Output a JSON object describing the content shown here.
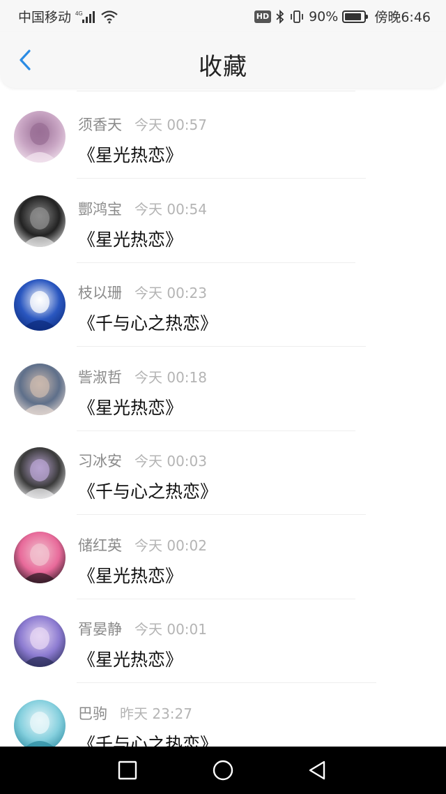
{
  "status_bar": {
    "carrier": "中国移动",
    "network": "4G",
    "hd": "HD",
    "battery_percent_label": "90%",
    "battery_level": 0.9,
    "time": "傍晚6:46"
  },
  "header": {
    "title": "收藏"
  },
  "favorites": [
    {
      "name": "须香天",
      "time": "今天 00:57",
      "title": "《星光热恋》",
      "avatar": {
        "colors": [
          "#f4e6f0",
          "#c9a6c4",
          "#9a6f96"
        ]
      }
    },
    {
      "name": "酆鸿宝",
      "time": "今天 00:54",
      "title": "《星光热恋》",
      "avatar": {
        "colors": [
          "#e8e8e8",
          "#222222",
          "#8c8c8c"
        ]
      }
    },
    {
      "name": "枝以珊",
      "time": "今天 00:23",
      "title": "《千与心之热恋》",
      "avatar": {
        "colors": [
          "#0b2a7a",
          "#2a57c0",
          "#ffffff"
        ]
      }
    },
    {
      "name": "訾淑哲",
      "time": "今天 00:18",
      "title": "《星光热恋》",
      "avatar": {
        "colors": [
          "#e6d9d2",
          "#5e6f8a",
          "#c9b8ae"
        ]
      }
    },
    {
      "name": "习冰安",
      "time": "今天 00:03",
      "title": "《千与心之热恋》",
      "avatar": {
        "colors": [
          "#f2f2f4",
          "#3a3a3a",
          "#b7a3d0"
        ]
      }
    },
    {
      "name": "储红英",
      "time": "今天 00:02",
      "title": "《星光热恋》",
      "avatar": {
        "colors": [
          "#2a1620",
          "#e86a9a",
          "#f1c2cf"
        ]
      }
    },
    {
      "name": "胥晏静",
      "time": "今天 00:01",
      "title": "《星光热恋》",
      "avatar": {
        "colors": [
          "#2b2e5a",
          "#8c7bd1",
          "#e6d6f3"
        ]
      }
    },
    {
      "name": "巴驹",
      "time": "昨天 23:27",
      "title": "《千与心之热恋》",
      "avatar": {
        "colors": [
          "#2a8aa0",
          "#86d0de",
          "#e9f7fa"
        ]
      }
    }
  ],
  "nav_bar": {
    "buttons": [
      "recent-apps",
      "home",
      "back"
    ]
  }
}
